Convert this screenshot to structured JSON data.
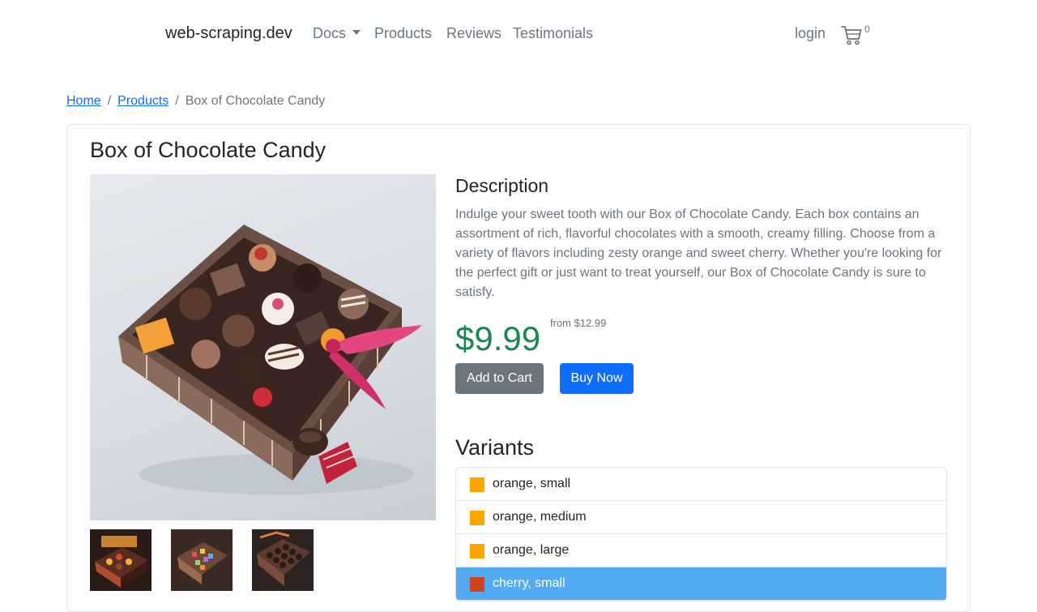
{
  "navbar": {
    "brand": "web-scraping.dev",
    "links": [
      {
        "label": "Docs",
        "has_dropdown": true
      },
      {
        "label": "Products"
      },
      {
        "label": "Reviews"
      },
      {
        "label": "Testimonials"
      }
    ],
    "login_label": "login",
    "cart_icon": "cart-icon",
    "cart_count": "0"
  },
  "breadcrumb": {
    "items": [
      "Home",
      "Products"
    ],
    "current": "Box of Chocolate Candy",
    "separator": "/"
  },
  "product": {
    "title": "Box of Chocolate Candy",
    "description_heading": "Description",
    "description": "Indulge your sweet tooth with our Box of Chocolate Candy. Each box contains an assortment of rich, flavorful chocolates with a smooth, creamy filling. Choose from a variety of flavors including zesty orange and sweet cherry. Whether you're looking for the perfect gift or just want to treat yourself, our Box of Chocolate Candy is sure to satisfy.",
    "price": "$9.99",
    "price_from": "from $12.99",
    "add_to_cart_label": "Add to Cart",
    "buy_now_label": "Buy Now",
    "variants_heading": "Variants",
    "variants": [
      {
        "label": "orange, small",
        "color": "#ffa500"
      },
      {
        "label": "orange, medium",
        "color": "#ffa500"
      },
      {
        "label": "orange, large",
        "color": "#ffa500"
      },
      {
        "label": "cherry, small",
        "color": "#d2411e"
      }
    ],
    "selected_variant": "cherry, small"
  },
  "colors": {
    "accent": "#0d6efd",
    "price": "#198754",
    "secondary": "#6c757d",
    "active_variant_bg": "#53aaf0"
  }
}
